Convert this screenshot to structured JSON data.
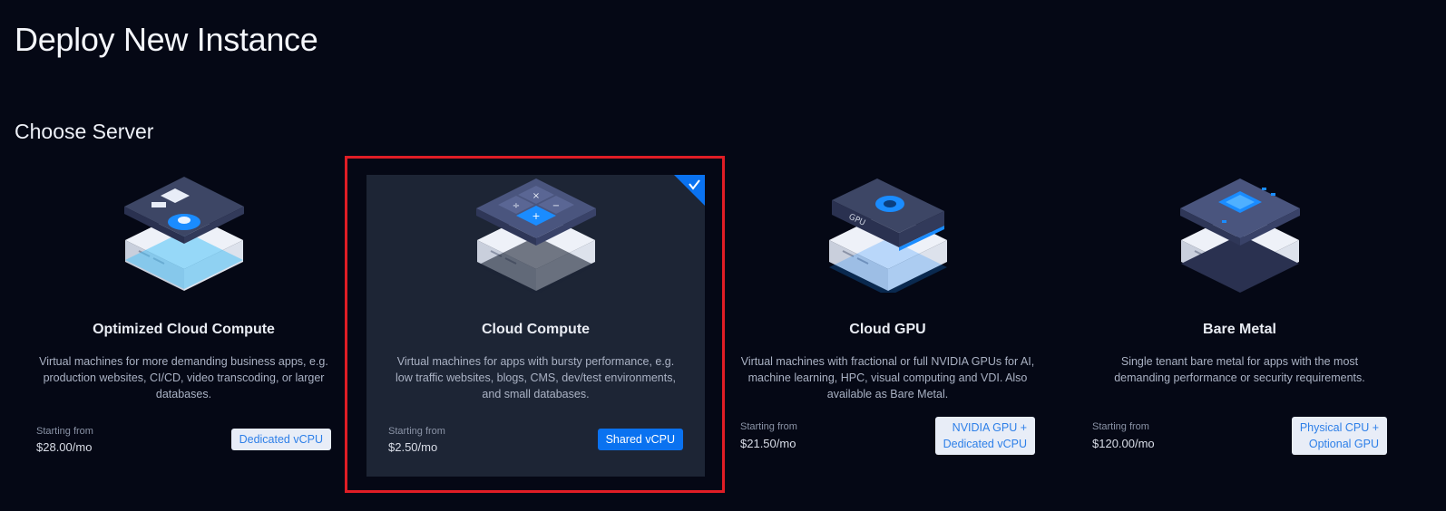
{
  "page": {
    "title": "Deploy New Instance",
    "section_title": "Choose Server"
  },
  "colors": {
    "background": "#050815",
    "selected_card": "#1d2535",
    "accent_blue": "#0a72f0",
    "highlight_red": "#e01d25"
  },
  "cards": [
    {
      "title": "Optimized Cloud Compute",
      "description": "Virtual machines for more demanding business apps, e.g. production websites, CI/CD, video transcoding, or larger databases.",
      "price_label": "Starting from",
      "price": "$28.00/mo",
      "badge": "Dedicated vCPU",
      "icon": "optimized-server-icon",
      "selected": false
    },
    {
      "title": "Cloud Compute",
      "description": "Virtual machines for apps with bursty performance, e.g. low traffic websites, blogs, CMS, dev/test environments, and small databases.",
      "price_label": "Starting from",
      "price": "$2.50/mo",
      "badge": "Shared vCPU",
      "icon": "calculator-server-icon",
      "selected": true
    },
    {
      "title": "Cloud GPU",
      "description": "Virtual machines with fractional or full NVIDIA GPUs for AI, machine learning, HPC, visual computing and VDI. Also available as Bare Metal.",
      "price_label": "Starting from",
      "price": "$21.50/mo",
      "badge": "NVIDIA GPU +\nDedicated vCPU",
      "icon": "gpu-server-icon",
      "selected": false
    },
    {
      "title": "Bare Metal",
      "description": "Single tenant bare metal for apps with the most demanding performance or security requirements.",
      "price_label": "Starting from",
      "price": "$120.00/mo",
      "badge": "Physical CPU +\nOptional GPU",
      "icon": "bare-metal-server-icon",
      "selected": false
    }
  ]
}
